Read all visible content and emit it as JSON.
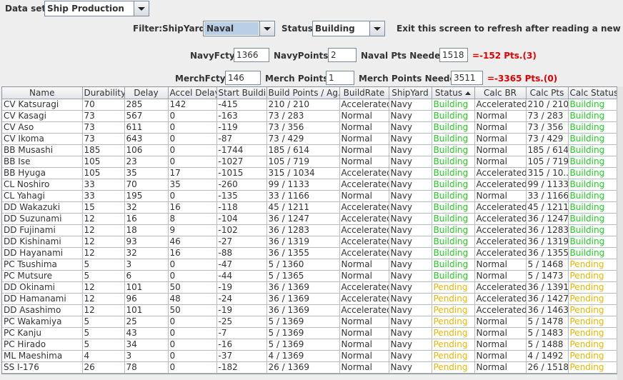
{
  "dataset": {
    "label": "Data set:",
    "value": "Ship Production"
  },
  "filter": {
    "label": "Filter:",
    "shipyard_label": "ShipYard:",
    "shipyard_value": "Naval",
    "status_label": "Status:",
    "status_value": "Building",
    "notice": "Exit this screen to refresh after reading a new turn"
  },
  "navy": {
    "fcty_label": "NavyFcty:",
    "fcty_value": "1366",
    "points_label": "NavyPoints:",
    "points_value": "2",
    "needed_label": "Naval Pts Needed:",
    "needed_value": "1518",
    "result": "=-152 Pts.(3)"
  },
  "merch": {
    "fcty_label": "MerchFcty:",
    "fcty_value": "146",
    "points_label": "Merch Points:",
    "points_value": "1",
    "needed_label": "Merch Points Needed:",
    "needed_value": "3511",
    "result": "=-3365 Pts.(0)"
  },
  "columns": [
    "Name",
    "Durability",
    "Delay",
    "Accel Delay",
    "Start Buildi...",
    "Build Points / Ag...",
    "BuildRate",
    "ShipYard",
    "Status",
    "Calc BR",
    "Calc Pts",
    "Calc Status"
  ],
  "rows": [
    [
      "CV Katsuragi",
      "70",
      "285",
      "142",
      "-415",
      "210 / 210",
      "Accelerated",
      "Navy",
      "Building",
      "Accelerated",
      "210 / 210",
      "Building"
    ],
    [
      "CV Kasagi",
      "73",
      "567",
      "0",
      "-163",
      "73 / 283",
      "Normal",
      "Navy",
      "Building",
      "Normal",
      "73 / 283",
      "Building"
    ],
    [
      "CV Aso",
      "73",
      "611",
      "0",
      "-119",
      "73 / 356",
      "Normal",
      "Navy",
      "Building",
      "Normal",
      "73 / 356",
      "Building"
    ],
    [
      "CV Ikoma",
      "73",
      "643",
      "0",
      "-87",
      "73 / 429",
      "Normal",
      "Navy",
      "Building",
      "Normal",
      "73 / 429",
      "Building"
    ],
    [
      "BB Musashi",
      "185",
      "106",
      "0",
      "-1744",
      "185 / 614",
      "Normal",
      "Navy",
      "Building",
      "Normal",
      "185 / 614",
      "Building"
    ],
    [
      "BB Ise",
      "105",
      "23",
      "0",
      "-1027",
      "105 / 719",
      "Normal",
      "Navy",
      "Building",
      "Normal",
      "105 / 719",
      "Building"
    ],
    [
      "BB Hyuga",
      "105",
      "35",
      "17",
      "-1015",
      "315 / 1034",
      "Accelerated",
      "Navy",
      "Building",
      "Accelerated",
      "315 / 10...",
      "Building"
    ],
    [
      "CL Noshiro",
      "33",
      "70",
      "35",
      "-260",
      "99 / 1133",
      "Accelerated",
      "Navy",
      "Building",
      "Accelerated",
      "99 / 1133",
      "Building"
    ],
    [
      "CL Yahagi",
      "33",
      "195",
      "0",
      "-135",
      "33 / 1166",
      "Normal",
      "Navy",
      "Building",
      "Normal",
      "33 / 1166",
      "Building"
    ],
    [
      "DD Wakazuki",
      "15",
      "32",
      "16",
      "-118",
      "45 / 1211",
      "Accelerated",
      "Navy",
      "Building",
      "Accelerated",
      "45 / 1211",
      "Building"
    ],
    [
      "DD Suzunami",
      "12",
      "16",
      "8",
      "-104",
      "36 / 1247",
      "Accelerated",
      "Navy",
      "Building",
      "Accelerated",
      "36 / 1247",
      "Building"
    ],
    [
      "DD Fujinami",
      "12",
      "18",
      "9",
      "-102",
      "36 / 1283",
      "Accelerated",
      "Navy",
      "Building",
      "Accelerated",
      "36 / 1283",
      "Building"
    ],
    [
      "DD Kishinami",
      "12",
      "93",
      "46",
      "-27",
      "36 / 1319",
      "Accelerated",
      "Navy",
      "Building",
      "Accelerated",
      "36 / 1319",
      "Building"
    ],
    [
      "DD Hayanami",
      "12",
      "32",
      "16",
      "-88",
      "36 / 1355",
      "Accelerated",
      "Navy",
      "Building",
      "Accelerated",
      "36 / 1355",
      "Building"
    ],
    [
      "PC Tsushima",
      "5",
      "3",
      "0",
      "-47",
      "5 / 1360",
      "Normal",
      "Navy",
      "Building",
      "Normal",
      "5 / 1468",
      "Pending"
    ],
    [
      "PC Mutsure",
      "5",
      "6",
      "0",
      "-44",
      "5 / 1365",
      "Normal",
      "Navy",
      "Building",
      "Normal",
      "5 / 1473",
      "Pending"
    ],
    [
      "DD Okinami",
      "12",
      "101",
      "50",
      "-19",
      "36 / 1369",
      "Accelerated",
      "Navy",
      "Pending",
      "Accelerated",
      "36 / 1391",
      "Pending"
    ],
    [
      "DD Hamanami",
      "12",
      "96",
      "48",
      "-24",
      "36 / 1369",
      "Accelerated",
      "Navy",
      "Pending",
      "Accelerated",
      "36 / 1427",
      "Pending"
    ],
    [
      "DD Asashimo",
      "12",
      "101",
      "50",
      "-19",
      "36 / 1369",
      "Accelerated",
      "Navy",
      "Pending",
      "Accelerated",
      "36 / 1463",
      "Pending"
    ],
    [
      "PC Wakamiya",
      "5",
      "25",
      "0",
      "-25",
      "5 / 1369",
      "Normal",
      "Navy",
      "Pending",
      "Normal",
      "5 / 1478",
      "Pending"
    ],
    [
      "PC Kanju",
      "5",
      "43",
      "0",
      "-7",
      "5 / 1369",
      "Normal",
      "Navy",
      "Pending",
      "Normal",
      "5 / 1483",
      "Pending"
    ],
    [
      "PC Hirado",
      "5",
      "34",
      "0",
      "-16",
      "5 / 1369",
      "Normal",
      "Navy",
      "Pending",
      "Normal",
      "5 / 1488",
      "Pending"
    ],
    [
      "ML Maeshima",
      "4",
      "3",
      "0",
      "-37",
      "4 / 1369",
      "Normal",
      "Navy",
      "Pending",
      "Normal",
      "4 / 1492",
      "Pending"
    ],
    [
      "SS I-176",
      "26",
      "78",
      "0",
      "-182",
      "26 / 1369",
      "Normal",
      "Navy",
      "Pending",
      "Normal",
      "26 / 1518",
      "Pending"
    ]
  ],
  "colors": {
    "building": "#22cc22",
    "pending": "#e8b800",
    "alert": "#e00000"
  },
  "sort": {
    "column": "Status",
    "direction": "ascending",
    "icon": "sort-ascending-icon"
  }
}
